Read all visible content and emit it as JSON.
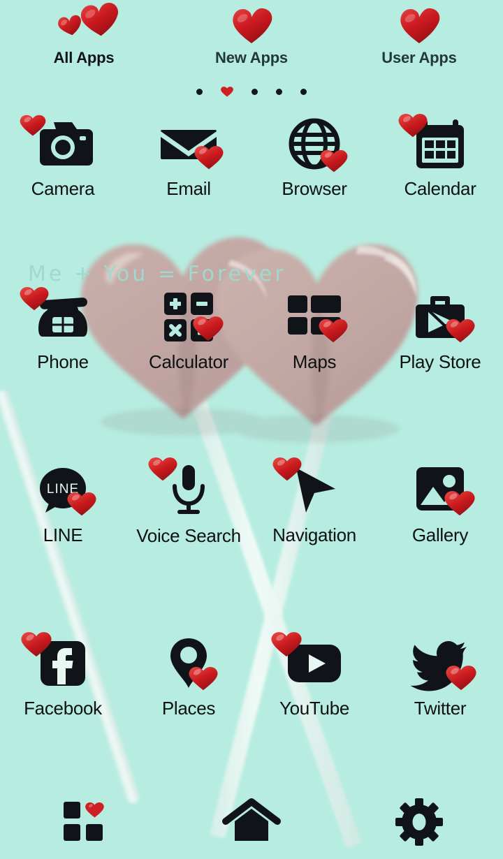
{
  "theme": {
    "background_color": "#b7ece0",
    "icon_color": "#101418",
    "heart_color": "#cf1f24",
    "label_color": "#0e1114",
    "wallpaper_text_color": "#9fd9cf",
    "lollipop_color": "#c3a8a5",
    "stick_color": "#e4f5ef"
  },
  "wallpaper": {
    "text": "Me + You = Forever"
  },
  "tabs": [
    {
      "label": "All Apps",
      "icon": "double-heart-icon",
      "active": true
    },
    {
      "label": "New Apps",
      "icon": "heart-icon",
      "active": false
    },
    {
      "label": "User Apps",
      "icon": "heart-icon",
      "active": false
    }
  ],
  "page_indicator": {
    "count": 5,
    "active_index": 1,
    "active_shape": "heart",
    "inactive_shape": "dot"
  },
  "apps": [
    {
      "label": "Camera",
      "icon": "camera-icon",
      "heart": "top-left"
    },
    {
      "label": "Email",
      "icon": "envelope-icon",
      "heart": "bottom-right"
    },
    {
      "label": "Browser",
      "icon": "globe-icon",
      "heart": "bottom-right"
    },
    {
      "label": "Calendar",
      "icon": "calendar-icon",
      "heart": "top-left"
    },
    {
      "label": "Phone",
      "icon": "phone-icon",
      "heart": "top-left"
    },
    {
      "label": "Calculator",
      "icon": "calculator-icon",
      "heart": "bottom-right"
    },
    {
      "label": "Maps",
      "icon": "maps-grid-icon",
      "heart": "bottom-right"
    },
    {
      "label": "Play Store",
      "icon": "play-store-icon",
      "heart": "bottom-right"
    },
    {
      "label": "LINE",
      "icon": "line-bubble-icon",
      "heart": "bottom-right"
    },
    {
      "label": "Voice Search",
      "icon": "microphone-icon",
      "heart": "top-left"
    },
    {
      "label": "Navigation",
      "icon": "navigation-arrow-icon",
      "heart": "top-left"
    },
    {
      "label": "Gallery",
      "icon": "photo-icon",
      "heart": "bottom-right"
    },
    {
      "label": "Facebook",
      "icon": "facebook-icon",
      "heart": "top-left"
    },
    {
      "label": "Places",
      "icon": "map-pin-icon",
      "heart": "bottom-right"
    },
    {
      "label": "YouTube",
      "icon": "youtube-icon",
      "heart": "top-left"
    },
    {
      "label": "Twitter",
      "icon": "twitter-bird-icon",
      "heart": "bottom-right"
    }
  ],
  "dock": [
    {
      "name": "all-apps",
      "icon": "apps-grid-heart-icon"
    },
    {
      "name": "home",
      "icon": "home-icon"
    },
    {
      "name": "settings",
      "icon": "gear-icon"
    }
  ]
}
